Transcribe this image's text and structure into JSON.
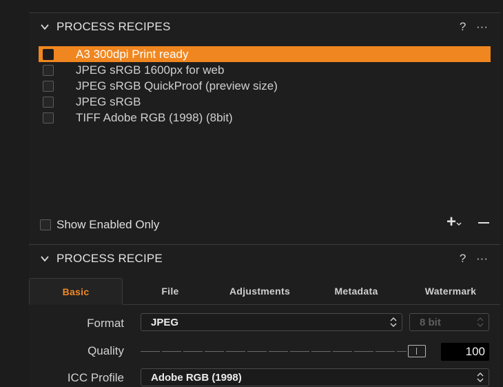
{
  "recipes_section": {
    "title": "PROCESS RECIPES",
    "help_label": "?",
    "more_label": "···",
    "items": [
      {
        "label": "A3 300dpi Print ready",
        "selected": true
      },
      {
        "label": "JPEG sRGB 1600px for web",
        "selected": false
      },
      {
        "label": "JPEG sRGB QuickProof (preview size)",
        "selected": false
      },
      {
        "label": "JPEG sRGB",
        "selected": false
      },
      {
        "label": "TIFF Adobe RGB (1998) (8bit)",
        "selected": false
      }
    ],
    "show_enabled_only_label": "Show Enabled Only",
    "add_label": "+",
    "remove_label": "−"
  },
  "recipe_section": {
    "title": "PROCESS RECIPE",
    "help_label": "?",
    "more_label": "···",
    "tabs": [
      {
        "label": "Basic",
        "active": true
      },
      {
        "label": "File",
        "active": false
      },
      {
        "label": "Adjustments",
        "active": false
      },
      {
        "label": "Metadata",
        "active": false
      },
      {
        "label": "Watermark",
        "active": false
      }
    ],
    "format": {
      "label": "Format",
      "value": "JPEG"
    },
    "bit_depth": {
      "value": "8 bit",
      "enabled": false
    },
    "quality": {
      "label": "Quality",
      "value": "100",
      "slider_fraction": 1.0
    },
    "icc_profile": {
      "label": "ICC Profile",
      "value": "Adobe RGB (1998)"
    }
  },
  "colors": {
    "accent": "#f0861f",
    "background": "#1e1e1e",
    "text": "#d6d6d6"
  }
}
